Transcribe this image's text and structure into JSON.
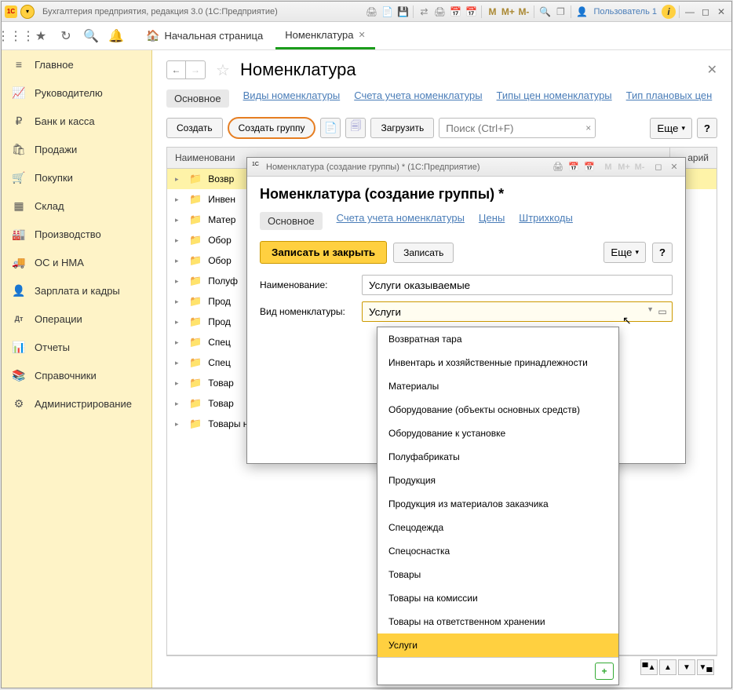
{
  "titlebar": {
    "appIcon": "1C",
    "title": "Бухгалтерия предприятия, редакция 3.0  (1С:Предприятие)",
    "user": "Пользователь 1",
    "icons": {
      "M": "M",
      "Mplus": "M+",
      "Mminus": "M-"
    }
  },
  "toolbar": {
    "tabs": [
      {
        "icon": "🏠",
        "label": "Начальная страница",
        "active": false
      },
      {
        "label": "Номенклатура",
        "active": true,
        "closable": true
      }
    ]
  },
  "sidebar": {
    "items": [
      {
        "icon": "≡",
        "label": "Главное"
      },
      {
        "icon": "📈",
        "label": "Руководителю"
      },
      {
        "icon": "₽",
        "label": "Банк и касса"
      },
      {
        "icon": "🛍",
        "label": "Продажи"
      },
      {
        "icon": "🛒",
        "label": "Покупки"
      },
      {
        "icon": "▦",
        "label": "Склад"
      },
      {
        "icon": "🏭",
        "label": "Производство"
      },
      {
        "icon": "🚚",
        "label": "ОС и НМА"
      },
      {
        "icon": "👤",
        "label": "Зарплата и кадры"
      },
      {
        "icon": "Дт",
        "label": "Операции"
      },
      {
        "icon": "📊",
        "label": "Отчеты"
      },
      {
        "icon": "📚",
        "label": "Справочники"
      },
      {
        "icon": "⚙",
        "label": "Администрирование"
      }
    ]
  },
  "main": {
    "title": "Номенклатура",
    "subtabs": [
      {
        "label": "Основное",
        "active": true
      },
      {
        "label": "Виды номенклатуры"
      },
      {
        "label": "Счета учета номенклатуры"
      },
      {
        "label": "Типы цен номенклатуры"
      },
      {
        "label": "Тип плановых цен"
      }
    ],
    "actions": {
      "create": "Создать",
      "createGroup": "Создать группу",
      "load": "Загрузить",
      "searchPlaceholder": "Поиск (Ctrl+F)",
      "more": "Еще"
    },
    "grid": {
      "headers": [
        "Наименовани",
        "арий"
      ],
      "rows": [
        {
          "label": "Возвр",
          "selected": true
        },
        {
          "label": "Инвен"
        },
        {
          "label": "Матер"
        },
        {
          "label": "Обор"
        },
        {
          "label": "Обор"
        },
        {
          "label": "Полуф"
        },
        {
          "label": "Прод"
        },
        {
          "label": "Прод"
        },
        {
          "label": "Спец"
        },
        {
          "label": "Спец"
        },
        {
          "label": "Товар"
        },
        {
          "label": "Товар"
        },
        {
          "label": "Товары на ответствен..."
        }
      ]
    }
  },
  "dialog": {
    "windowTitle": "Номенклатура (создание группы) * (1С:Предприятие)",
    "title": "Номенклатура (создание группы) *",
    "tabs": [
      {
        "label": "Основное",
        "active": true
      },
      {
        "label": "Счета учета номенклатуры"
      },
      {
        "label": "Цены"
      },
      {
        "label": "Штрихкоды"
      }
    ],
    "actions": {
      "saveClose": "Записать и закрыть",
      "save": "Записать",
      "more": "Еще"
    },
    "fields": {
      "nameLabel": "Наименование:",
      "nameValue": "Услуги оказываемые",
      "typeLabel": "Вид номенклатуры:",
      "typeValue": "Услуги"
    }
  },
  "dropdown": {
    "items": [
      "Возвратная тара",
      "Инвентарь и хозяйственные принадлежности",
      "Материалы",
      "Оборудование (объекты основных средств)",
      "Оборудование к установке",
      "Полуфабрикаты",
      "Продукция",
      "Продукция из материалов заказчика",
      "Спецодежда",
      "Спецоснастка",
      "Товары",
      "Товары на комиссии",
      "Товары на ответственном хранении",
      "Услуги"
    ],
    "selected": "Услуги"
  }
}
